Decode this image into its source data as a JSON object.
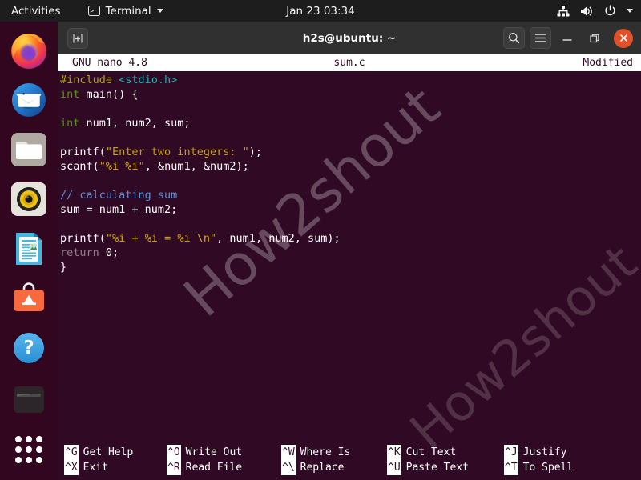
{
  "topbar": {
    "activities": "Activities",
    "app_menu": {
      "label": "Terminal",
      "icon": "terminal-icon",
      "caret": "chevron-down-icon"
    },
    "clock": "Jan 23  03:34",
    "tray": [
      {
        "name": "network-icon"
      },
      {
        "name": "volume-icon"
      },
      {
        "name": "power-icon"
      },
      {
        "name": "chevron-down-icon"
      }
    ]
  },
  "dock": {
    "items": [
      {
        "name": "firefox",
        "label": "Firefox"
      },
      {
        "name": "thunderbird",
        "label": "Thunderbird Mail"
      },
      {
        "name": "files",
        "label": "Files"
      },
      {
        "name": "rhythmbox",
        "label": "Rhythmbox"
      },
      {
        "name": "libreoffice-writer",
        "label": "LibreOffice Writer"
      },
      {
        "name": "ubuntu-software",
        "label": "Ubuntu Software"
      },
      {
        "name": "help",
        "label": "Help"
      },
      {
        "name": "trash",
        "label": "Trash"
      }
    ],
    "show_apps": "Show Applications"
  },
  "window": {
    "title": "h2s@ubuntu: ~",
    "new_tab": "new-tab",
    "controls": {
      "search": "search-icon",
      "menu": "hamburger-menu-icon",
      "minimize": "minimize-icon",
      "maximize": "maximize-icon",
      "close": "close-icon"
    }
  },
  "nano": {
    "header": {
      "version": "GNU nano 4.8",
      "filename": "sum.c",
      "status": "Modified"
    },
    "code_lines": [
      [
        {
          "t": "#include ",
          "c": "k-pre"
        },
        {
          "t": "<stdio.h>",
          "c": "k-hdr"
        }
      ],
      [
        {
          "t": "int",
          "c": "k-type"
        },
        {
          "t": " main() {",
          "c": "k-txt"
        }
      ],
      [
        {
          "t": "",
          "c": "k-txt"
        }
      ],
      [
        {
          "t": "int",
          "c": "k-type"
        },
        {
          "t": " num1, num2, sum;",
          "c": "k-txt"
        }
      ],
      [
        {
          "t": "",
          "c": "k-txt"
        }
      ],
      [
        {
          "t": "printf(",
          "c": "k-txt"
        },
        {
          "t": "\"Enter two integers: \"",
          "c": "k-str"
        },
        {
          "t": ");",
          "c": "k-txt"
        }
      ],
      [
        {
          "t": "scanf(",
          "c": "k-txt"
        },
        {
          "t": "\"",
          "c": "k-str"
        },
        {
          "t": "%i %i",
          "c": "k-esc"
        },
        {
          "t": "\"",
          "c": "k-str"
        },
        {
          "t": ", &num1, &num2);",
          "c": "k-txt"
        }
      ],
      [
        {
          "t": "",
          "c": "k-txt"
        }
      ],
      [
        {
          "t": "// calculating sum",
          "c": "k-cmt"
        }
      ],
      [
        {
          "t": "sum = num1 + num2;",
          "c": "k-txt"
        }
      ],
      [
        {
          "t": "",
          "c": "k-txt"
        }
      ],
      [
        {
          "t": "printf(",
          "c": "k-txt"
        },
        {
          "t": "\"",
          "c": "k-str"
        },
        {
          "t": "%i",
          "c": "k-esc"
        },
        {
          "t": " + ",
          "c": "k-str"
        },
        {
          "t": "%i",
          "c": "k-esc"
        },
        {
          "t": " = ",
          "c": "k-str"
        },
        {
          "t": "%i",
          "c": "k-esc"
        },
        {
          "t": " ",
          "c": "k-str"
        },
        {
          "t": "\\n",
          "c": "k-esc"
        },
        {
          "t": "\"",
          "c": "k-str"
        },
        {
          "t": ", num1, num2, sum);",
          "c": "k-txt"
        }
      ],
      [
        {
          "t": "return",
          "c": "k-ret"
        },
        {
          "t": " 0;",
          "c": "k-txt"
        }
      ],
      [
        {
          "t": "}",
          "c": "k-txt"
        }
      ]
    ],
    "shortcuts_row1": [
      {
        "key": "^G",
        "label": "Get Help"
      },
      {
        "key": "^O",
        "label": "Write Out"
      },
      {
        "key": "^W",
        "label": "Where Is"
      },
      {
        "key": "^K",
        "label": "Cut Text"
      },
      {
        "key": "^J",
        "label": "Justify"
      }
    ],
    "shortcuts_row2": [
      {
        "key": "^X",
        "label": "Exit"
      },
      {
        "key": "^R",
        "label": "Read File"
      },
      {
        "key": "^\\",
        "label": "Replace"
      },
      {
        "key": "^U",
        "label": "Paste Text"
      },
      {
        "key": "^T",
        "label": "To Spell"
      }
    ]
  },
  "watermark": {
    "text": "How2shout",
    "top_fragment": "How2shout",
    "bottom_fragment": "How2shout"
  },
  "colors": {
    "desktop_bg": "#2c001e",
    "dock_bg": "#32061f",
    "topbar_bg": "#1d1d1d",
    "titlebar_bg": "#303030",
    "terminal_bg": "#300a24",
    "close_button": "#e0512a",
    "nano_header_bg": "#ffffff"
  }
}
